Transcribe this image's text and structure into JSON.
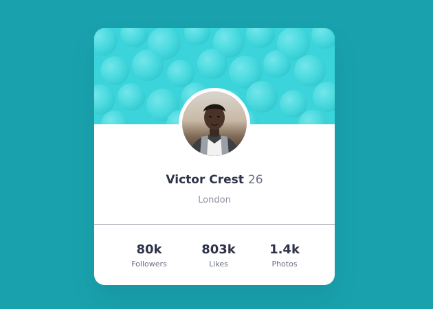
{
  "profile": {
    "name": "Victor Crest",
    "age": "26",
    "location": "London",
    "avatar_icon": "profile-photo"
  },
  "stats": [
    {
      "value": "80k",
      "label": "Followers"
    },
    {
      "value": "803k",
      "label": "Likes"
    },
    {
      "value": "1.4k",
      "label": "Photos"
    }
  ],
  "colors": {
    "page_background": "#19a2ae",
    "header_background": "#3bd4da",
    "card_background": "#ffffff",
    "primary_text": "#2e3349",
    "secondary_text": "#6b7082"
  }
}
